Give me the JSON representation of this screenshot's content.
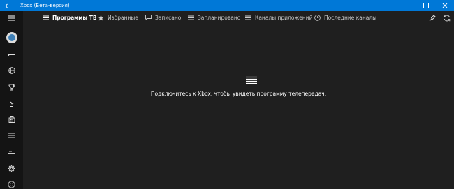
{
  "window": {
    "title": "Xbox (Бета-версия)",
    "back_icon": "back-arrow-icon",
    "controls": [
      "minimize-icon",
      "maximize-icon",
      "close-icon"
    ],
    "accent_color": "#0078d7"
  },
  "sidebar": {
    "items": [
      {
        "name": "hamburger-menu",
        "icon": "hamburger-icon"
      },
      {
        "name": "profile-avatar",
        "icon": "avatar"
      },
      {
        "name": "home",
        "icon": "home-icon"
      },
      {
        "name": "network",
        "icon": "globe-icon"
      },
      {
        "name": "achievements",
        "icon": "trophy-icon"
      },
      {
        "name": "game-dvr",
        "icon": "dvr-icon"
      },
      {
        "name": "store",
        "icon": "store-icon"
      },
      {
        "name": "onegude",
        "icon": "list-icon"
      },
      {
        "name": "connect",
        "icon": "console-icon"
      },
      {
        "name": "settings",
        "icon": "gear-icon"
      },
      {
        "name": "feedback",
        "icon": "smiley-icon"
      }
    ]
  },
  "tabs": [
    {
      "label": "Программы ТВ",
      "icon": "list-icon",
      "active": true
    },
    {
      "label": "Избранные",
      "icon": "star-icon",
      "active": false
    },
    {
      "label": "Записано",
      "icon": "recorded-icon",
      "active": false
    },
    {
      "label": "Запланировано",
      "icon": "scheduled-icon",
      "active": false
    },
    {
      "label": "Каналы приложений",
      "icon": "list-icon",
      "active": false
    },
    {
      "label": "Последние каналы",
      "icon": "clock-icon",
      "active": false
    }
  ],
  "toolbar_right": [
    "remote-icon",
    "refresh-icon"
  ],
  "main": {
    "glyph": "list-icon",
    "message": "Подключитесь к Xbox, чтобы увидеть программу телепередач."
  }
}
